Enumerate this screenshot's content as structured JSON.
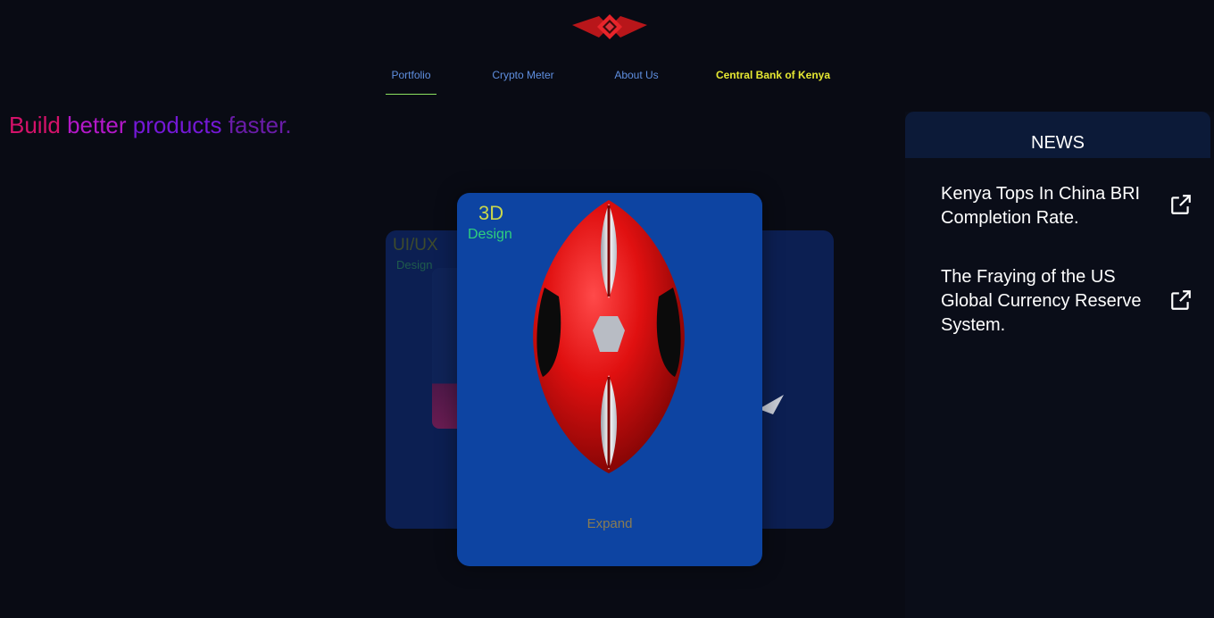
{
  "logo": {
    "icon": "diamond-logo-icon"
  },
  "nav": {
    "items": [
      {
        "label": "Portfolio"
      },
      {
        "label": "Crypto Meter"
      },
      {
        "label": "About Us"
      },
      {
        "label": "Central Bank of Kenya"
      }
    ],
    "active": "Portfolio"
  },
  "tagline": {
    "words": [
      "Build",
      "better",
      "products",
      "faster."
    ],
    "colors": [
      "#d4126a",
      "#b318c8",
      "#7418d6",
      "#6a1ca8"
    ]
  },
  "cards": {
    "back": {
      "title": "UI/UX",
      "subtitle": "Design"
    },
    "front": {
      "title": "3D",
      "subtitle": "Design",
      "action": "Expand"
    }
  },
  "news": {
    "header": "NEWS",
    "items": [
      {
        "title": "Kenya Tops In China BRI Completion Rate.",
        "icon": "external-link-icon"
      },
      {
        "title": "The Fraying of the US Global Currency Reserve System.",
        "icon": "external-link-icon"
      }
    ]
  }
}
